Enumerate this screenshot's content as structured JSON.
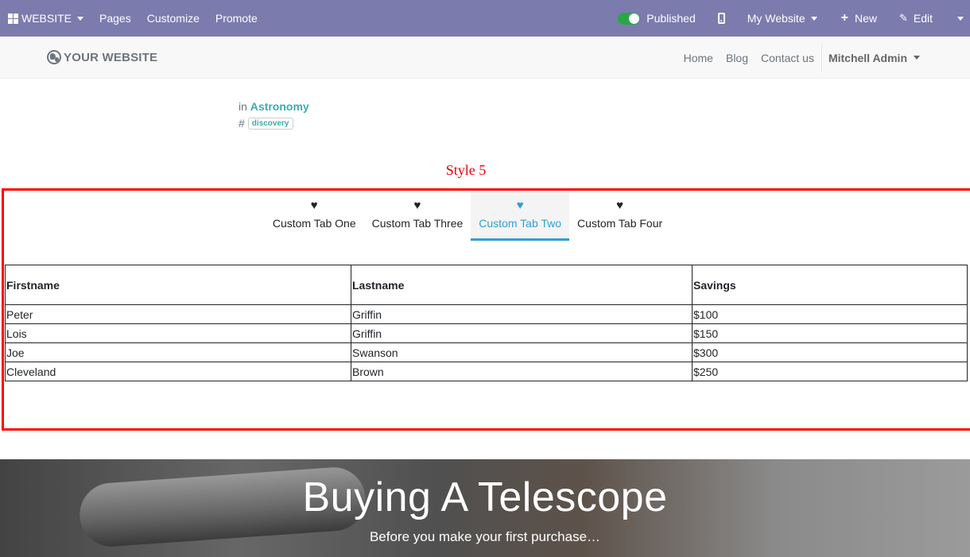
{
  "adminbar": {
    "app_label": "WEBSITE",
    "menu": [
      "Pages",
      "Customize",
      "Promote"
    ],
    "published_label": "Published",
    "website_label": "My Website",
    "new_label": "New",
    "edit_label": "Edit"
  },
  "sitenav": {
    "logo": "YOUR WEBSITE",
    "links": [
      "Home",
      "Blog",
      "Contact us"
    ],
    "user": "Mitchell Admin"
  },
  "post": {
    "in_label": "in",
    "category": "Astronomy",
    "hash": "#",
    "tag": "discovery"
  },
  "section_title": "Style 5",
  "tabs": [
    {
      "label": "Custom Tab One",
      "icon": "heart-icon",
      "active": false
    },
    {
      "label": "Custom Tab Three",
      "icon": "heart-icon",
      "active": false
    },
    {
      "label": "Custom Tab Two",
      "icon": "heart-icon",
      "active": true
    },
    {
      "label": "Custom Tab Four",
      "icon": "heart-icon",
      "active": false
    }
  ],
  "table": {
    "headers": [
      "Firstname",
      "Lastname",
      "Savings"
    ],
    "rows": [
      [
        "Peter",
        "Griffin",
        "$100"
      ],
      [
        "Lois",
        "Griffin",
        "$150"
      ],
      [
        "Joe",
        "Swanson",
        "$300"
      ],
      [
        "Cleveland",
        "Brown",
        "$250"
      ]
    ]
  },
  "hero": {
    "title": "Buying A Telescope",
    "subtitle": "Before you make your first purchase…"
  },
  "colors": {
    "adminbar": "#7c7bad",
    "accent_tab": "#2f9fd8",
    "category": "#3aadaa",
    "highlight_box": "#ff0000"
  }
}
